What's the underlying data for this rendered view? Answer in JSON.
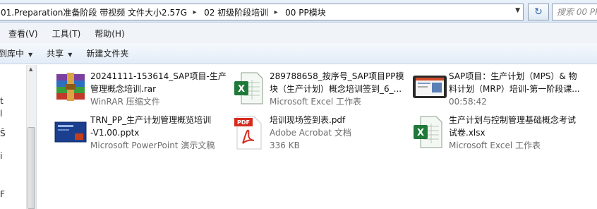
{
  "address_bar": {
    "crumbs": [
      "01.Preparation准备阶段 带视频 文件大小2.57G",
      "02 初级阶段培训",
      "00 PP模块"
    ],
    "refresh_icon": "refresh-icon",
    "search_placeholder": "搜索 00 PP"
  },
  "menubar": {
    "items": [
      "查看(V)",
      "工具(T)",
      "帮助(H)"
    ]
  },
  "toolbar": {
    "include_library": "到库中",
    "share": "共享",
    "new_folder": "新建文件夹"
  },
  "files": [
    {
      "name_line1": "20241111-153614_SAP项目-生产",
      "name_line2": "管理概念培训.rar",
      "type": "WinRAR 压缩文件",
      "icon": "winrar-icon"
    },
    {
      "name_line1": "289788658_按序号_SAP项目PP模",
      "name_line2": "块（生产计划）概念培训签到_6_...",
      "type": "Microsoft Excel 工作表",
      "icon": "excel-icon"
    },
    {
      "name_line1": "SAP项目：生产计划（MPS）& 物",
      "name_line2": "料计划（MRP）培训-第一阶段课...",
      "type": "00:58:42",
      "icon": "video-thumbnail-icon"
    },
    {
      "name_line1": "TRN_PP_生产计划管理概览培训",
      "name_line2": "-V1.00.pptx",
      "type": "Microsoft PowerPoint 演示文稿",
      "icon": "powerpoint-icon"
    },
    {
      "name_line1": "培训现场签到表.pdf",
      "type": "Adobe Acrobat 文档",
      "size": "336 KB",
      "icon": "pdf-icon"
    },
    {
      "name_line1": "生产计划与控制管理基础概念考试",
      "name_line2": "试卷.xlsx",
      "type": "Microsoft Excel 工作表",
      "icon": "excel-icon"
    }
  ],
  "navpane_glyphs": [
    "t",
    "l",
    "Š",
    "i",
    "F"
  ]
}
